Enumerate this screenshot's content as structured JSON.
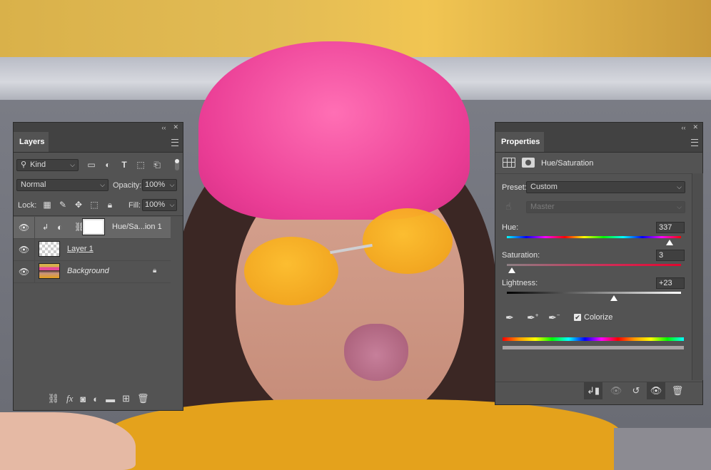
{
  "layers_panel": {
    "tab_title": "Layers",
    "filter_kind": "Kind",
    "blend_mode": "Normal",
    "opacity_label": "Opacity:",
    "opacity_value": "100%",
    "lock_label": "Lock:",
    "fill_label": "Fill:",
    "fill_value": "100%",
    "layers": [
      {
        "name": "Hue/Sa...ion 1",
        "type": "adjustment"
      },
      {
        "name": "Layer 1",
        "type": "pixel"
      },
      {
        "name": "Background",
        "type": "background"
      }
    ]
  },
  "properties_panel": {
    "tab_title": "Properties",
    "adjustment_name": "Hue/Saturation",
    "preset_label": "Preset:",
    "preset_value": "Custom",
    "channel_value": "Master",
    "hue_label": "Hue:",
    "hue_value": "337",
    "saturation_label": "Saturation:",
    "saturation_value": "3",
    "lightness_label": "Lightness:",
    "lightness_value": "+23",
    "colorize_label": "Colorize",
    "colorize_checked": true,
    "hue_range": [
      -180,
      180
    ],
    "saturation_range": [
      0,
      100
    ],
    "lightness_range": [
      -100,
      100
    ]
  },
  "panel_controls": {
    "collapse_glyph": "‹‹",
    "close_glyph": "✕"
  }
}
